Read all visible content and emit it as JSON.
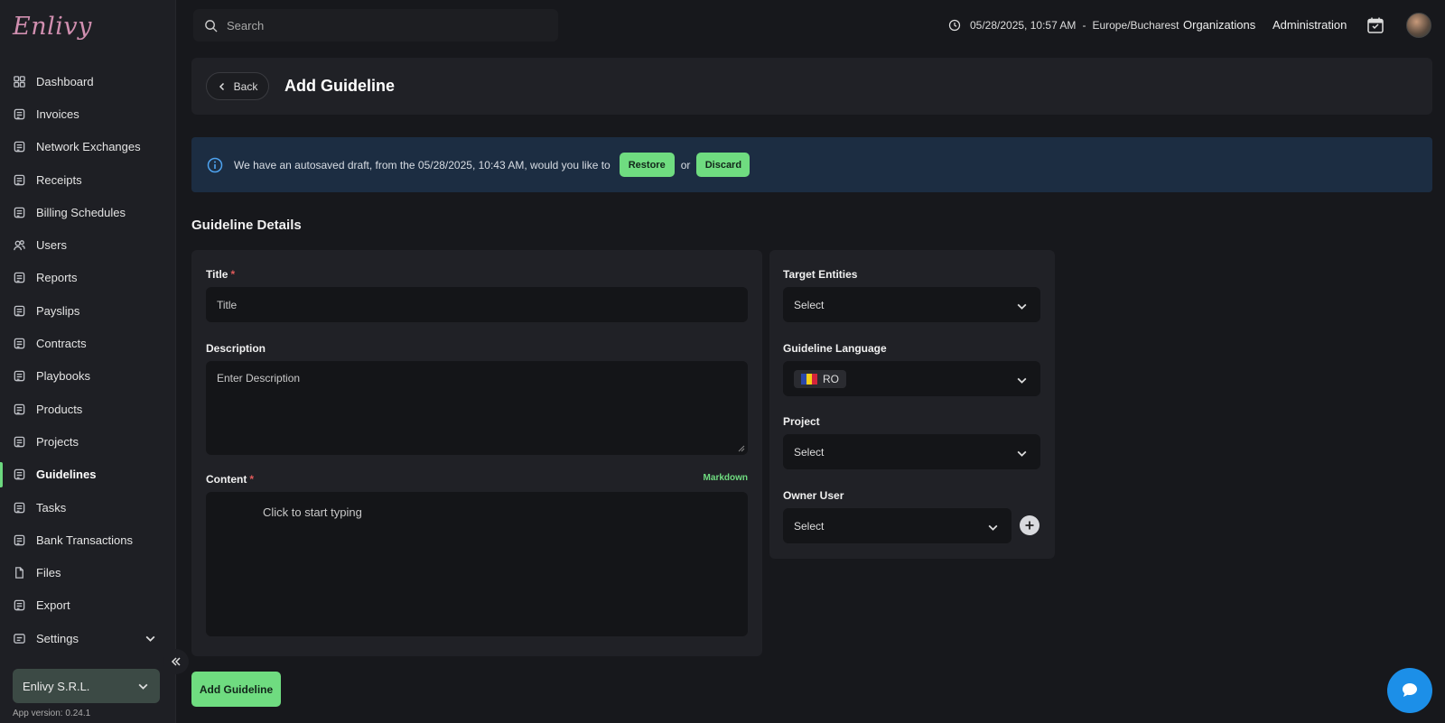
{
  "brand": {
    "logo_text": "Enlivy"
  },
  "sidebar": {
    "items": [
      {
        "label": "Dashboard",
        "icon": "dashboard-icon"
      },
      {
        "label": "Invoices",
        "icon": "invoice-icon"
      },
      {
        "label": "Network Exchanges",
        "icon": "exchange-icon"
      },
      {
        "label": "Receipts",
        "icon": "receipt-icon"
      },
      {
        "label": "Billing Schedules",
        "icon": "billing-schedule-icon"
      },
      {
        "label": "Users",
        "icon": "users-icon"
      },
      {
        "label": "Reports",
        "icon": "reports-icon"
      },
      {
        "label": "Payslips",
        "icon": "payslip-icon"
      },
      {
        "label": "Contracts",
        "icon": "contract-icon"
      },
      {
        "label": "Playbooks",
        "icon": "playbook-icon"
      },
      {
        "label": "Products",
        "icon": "product-icon"
      },
      {
        "label": "Projects",
        "icon": "project-icon"
      },
      {
        "label": "Guidelines",
        "icon": "guideline-icon",
        "active": true
      },
      {
        "label": "Tasks",
        "icon": "tasks-icon"
      },
      {
        "label": "Bank Transactions",
        "icon": "bank-icon"
      },
      {
        "label": "Files",
        "icon": "file-icon"
      },
      {
        "label": "Export",
        "icon": "export-icon"
      },
      {
        "label": "Settings",
        "icon": "settings-icon"
      }
    ],
    "organization": "Enlivy S.R.L.",
    "app_version": "App version: 0.24.1"
  },
  "topbar": {
    "search_placeholder": "Search",
    "datetime": "05/28/2025, 10:57 AM",
    "separator": "-",
    "timezone": "Europe/Bucharest",
    "organizations_label": "Organizations",
    "administration_label": "Administration"
  },
  "header": {
    "back_label": "Back",
    "title": "Add Guideline"
  },
  "banner": {
    "message": "We have an autosaved draft, from the 05/28/2025, 10:43 AM, would you like to",
    "restore_label": "Restore",
    "or_text": "or",
    "discard_label": "Discard"
  },
  "form": {
    "section_title": "Guideline Details",
    "title_label": "Title",
    "required_mark": "*",
    "title_placeholder": "Title",
    "description_label": "Description",
    "description_placeholder": "Enter Description",
    "content_label": "Content",
    "markdown_label": "Markdown",
    "content_placeholder": "Click to start typing",
    "submit_label": "Add Guideline"
  },
  "side": {
    "target_entities_label": "Target Entities",
    "target_entities_value": "Select",
    "language_label": "Guideline Language",
    "language_value": "RO",
    "project_label": "Project",
    "project_value": "Select",
    "owner_label": "Owner User",
    "owner_value": "Select"
  },
  "colors": {
    "accent": "#6fdc80",
    "banner_bg": "#1c2d42",
    "chat": "#1c8fe8"
  }
}
